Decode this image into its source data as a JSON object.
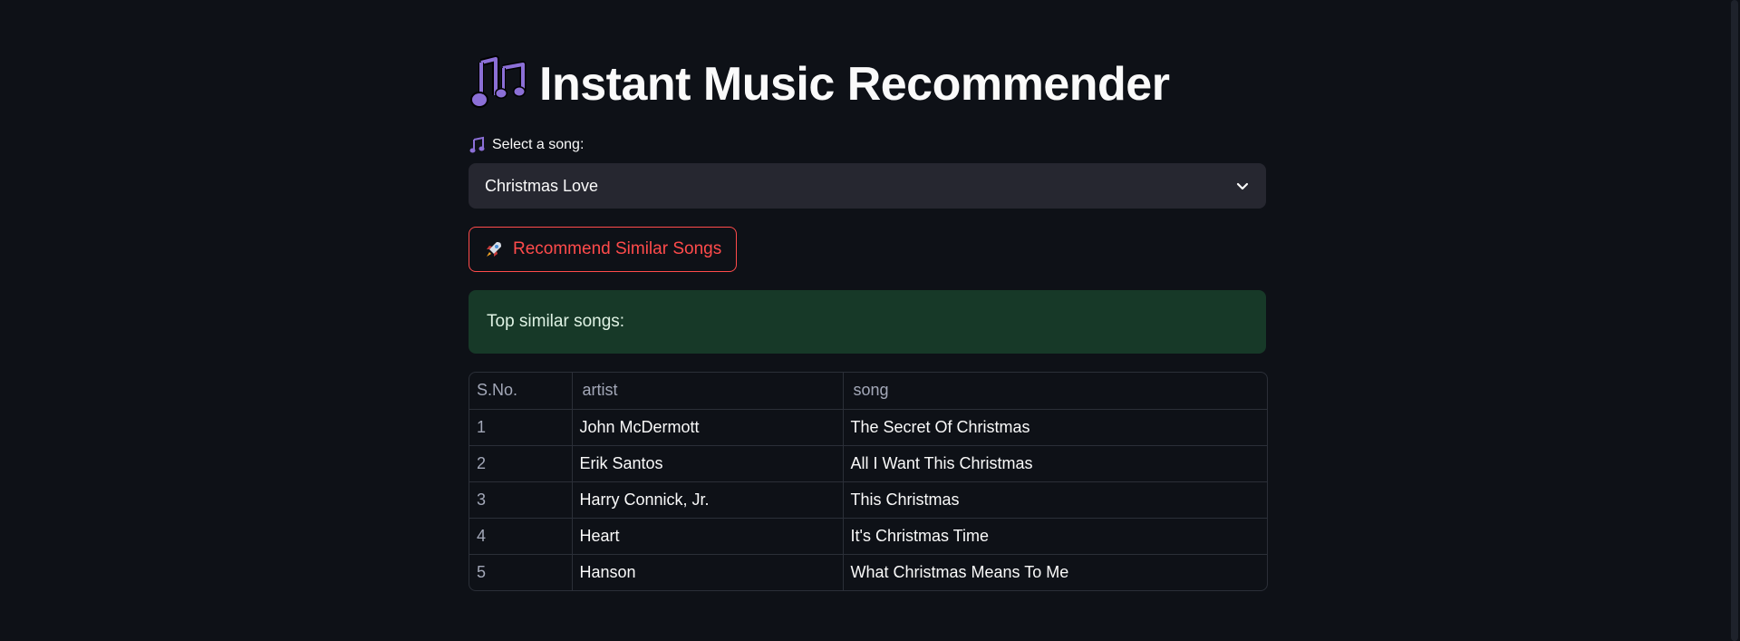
{
  "app": {
    "title": "Instant Music Recommender",
    "title_icon": "music-notes-icon"
  },
  "select": {
    "label": "Select a song:",
    "label_icon": "musical-note-icon",
    "value": "Christmas Love"
  },
  "button": {
    "label": "Recommend Similar Songs",
    "icon": "rocket-icon"
  },
  "result": {
    "message": "Top similar songs:"
  },
  "table": {
    "headers": [
      "S.No.",
      "artist",
      "song"
    ],
    "rows": [
      {
        "idx": "1",
        "artist": "John McDermott",
        "song": "The Secret Of Christmas"
      },
      {
        "idx": "2",
        "artist": "Erik Santos",
        "song": "All I Want This Christmas"
      },
      {
        "idx": "3",
        "artist": "Harry Connick, Jr.",
        "song": "This Christmas"
      },
      {
        "idx": "4",
        "artist": "Heart",
        "song": "It's Christmas Time"
      },
      {
        "idx": "5",
        "artist": "Hanson",
        "song": "What Christmas Means To Me"
      }
    ]
  },
  "colors": {
    "background": "#0e1117",
    "accent": "#ff4b4b",
    "success_bg": "#173928",
    "select_bg": "#262730"
  }
}
